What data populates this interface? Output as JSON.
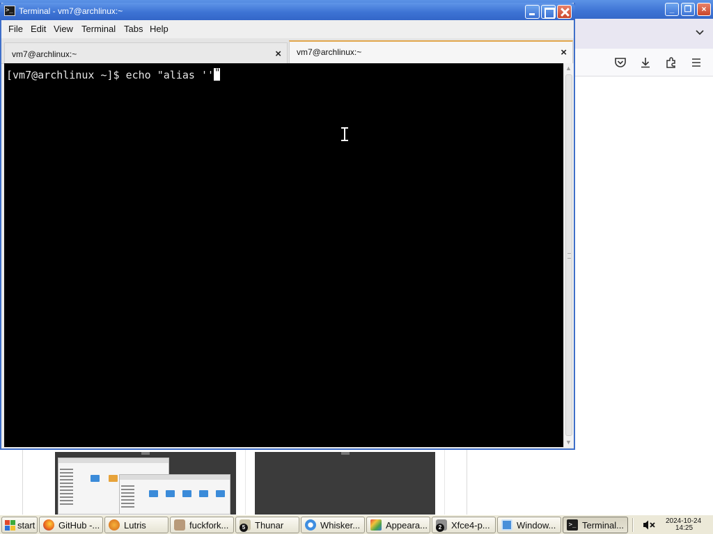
{
  "terminal": {
    "window_title": "Terminal - vm7@archlinux:~",
    "app_icon_glyph": ">_",
    "menu": [
      "File",
      "Edit",
      "View",
      "Terminal",
      "Tabs",
      "Help"
    ],
    "tabs": [
      {
        "label": "vm7@archlinux:~",
        "close": "×",
        "active": false
      },
      {
        "label": "vm7@archlinux:~",
        "close": "×",
        "active": true
      }
    ],
    "prompt": "[vm7@archlinux ~]$ ",
    "command": "echo \"alias ''",
    "cursor_char": "\"",
    "colors": {
      "background": "#000000",
      "text": "#e6e6e6",
      "active_tab_accent": "#e2a64b",
      "titlebar": "#3d73d4"
    }
  },
  "browser": {
    "window_controls": {
      "minimize": "_",
      "restore": "❐",
      "close": "×"
    },
    "tabs_menu_icon": "chevron-down-icon",
    "toolbar_icons": [
      "pocket-icon",
      "download-icon",
      "extensions-icon",
      "menu-icon"
    ]
  },
  "taskbar": {
    "start_label": "start",
    "items": [
      {
        "label": "GitHub -...",
        "icon": "firefox-icon"
      },
      {
        "label": "Lutris",
        "icon": "lutris-icon"
      },
      {
        "label": "fuckfork...",
        "icon": "app-icon"
      },
      {
        "label": "Thunar",
        "icon": "thunar-icon",
        "badge": "5"
      },
      {
        "label": "Whisker...",
        "icon": "whisker-icon"
      },
      {
        "label": "Appeara...",
        "icon": "appearance-icon"
      },
      {
        "label": "Xfce4-p...",
        "icon": "xfce-icon",
        "badge": "2"
      },
      {
        "label": "Window...",
        "icon": "window-icon"
      },
      {
        "label": "Terminal...",
        "icon": "terminal-icon"
      }
    ],
    "clock": {
      "date": "2024-10-24",
      "time": "14:25"
    },
    "volume_icon": "volume-muted-icon"
  }
}
